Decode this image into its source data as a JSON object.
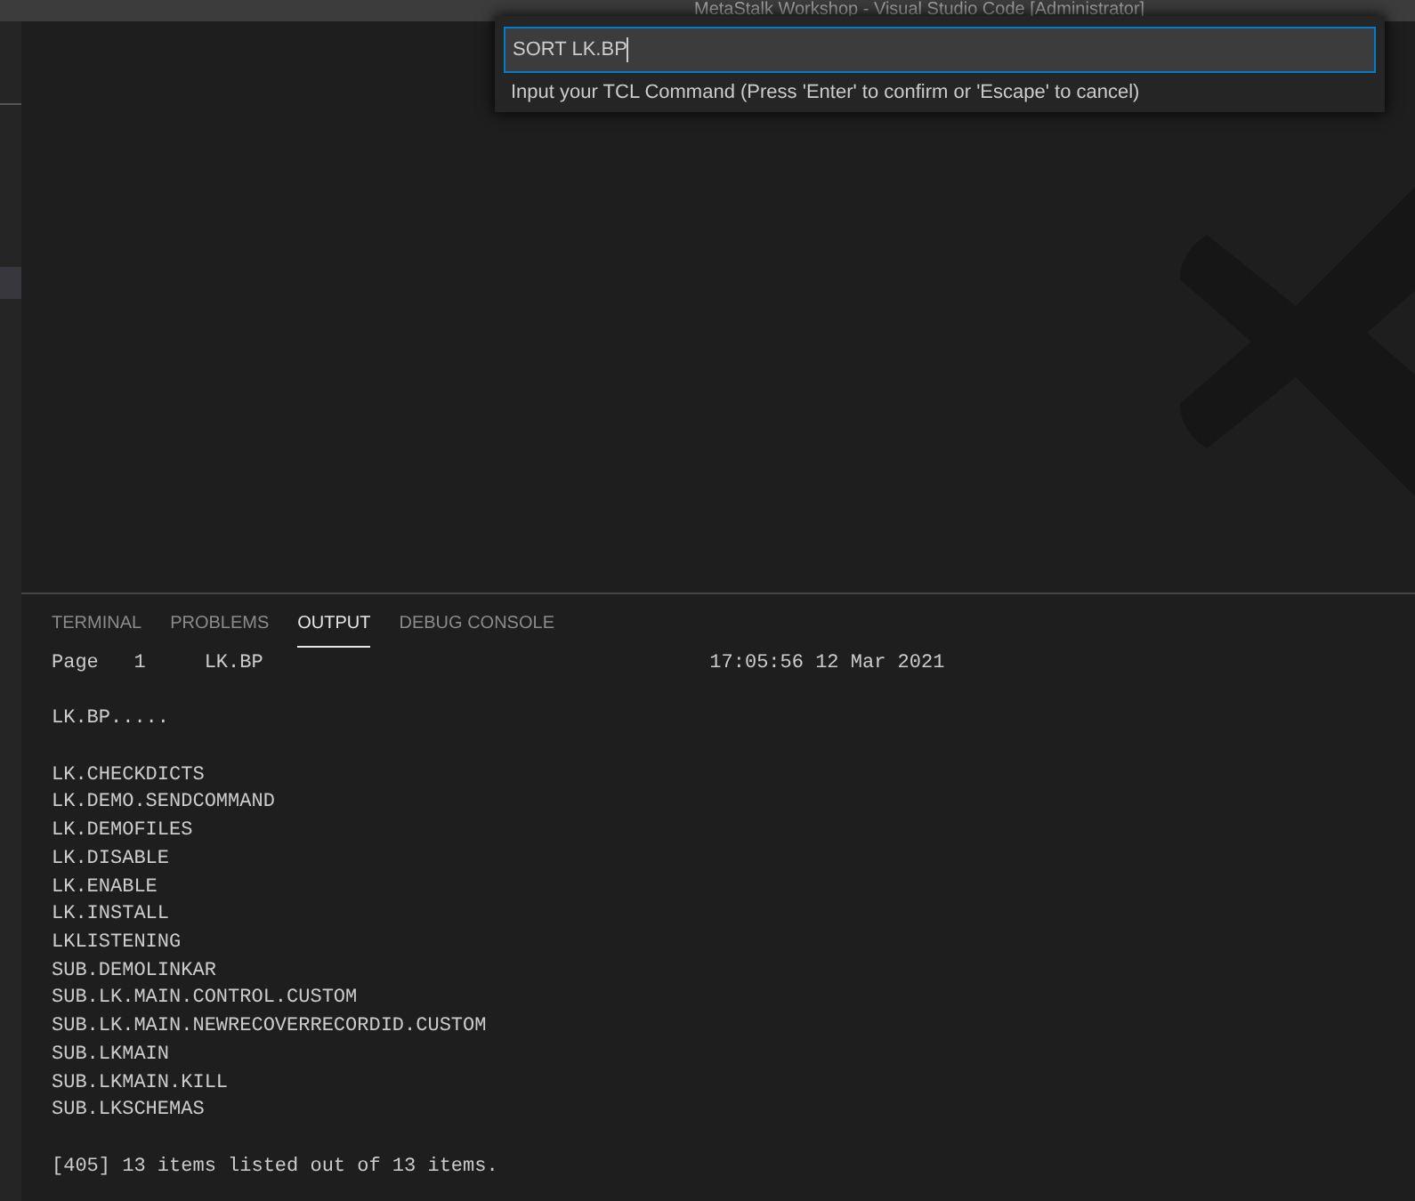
{
  "window": {
    "title": "MetaStalk Workshop - Visual Studio Code [Administrator]"
  },
  "quick_input": {
    "value": "SORT LK.BP",
    "message": "Input your TCL Command (Press 'Enter' to confirm or 'Escape' to cancel)"
  },
  "panel": {
    "tabs": [
      {
        "label": "TERMINAL",
        "selected": false
      },
      {
        "label": "PROBLEMS",
        "selected": false
      },
      {
        "label": "OUTPUT",
        "selected": true
      },
      {
        "label": "DEBUG CONSOLE",
        "selected": false
      }
    ],
    "output": [
      {
        "lines": [
          "Page   1     LK.BP                                      17:05:56 12 Mar 2021"
        ]
      },
      {
        "lines": [
          "LK.BP....."
        ]
      },
      {
        "lines": [
          "LK.CHECKDICTS",
          "LK.DEMO.SENDCOMMAND",
          "LK.DEMOFILES",
          "LK.DISABLE",
          "LK.ENABLE",
          "LK.INSTALL",
          "LKLISTENING",
          "SUB.DEMOLINKAR",
          "SUB.LK.MAIN.CONTROL.CUSTOM",
          "SUB.LK.MAIN.NEWRECOVERRECORDID.CUSTOM",
          "SUB.LKMAIN",
          "SUB.LKMAIN.KILL",
          "SUB.LKSCHEMAS"
        ]
      },
      {
        "lines": [
          "[405] 13 items listed out of 13 items."
        ]
      }
    ]
  }
}
